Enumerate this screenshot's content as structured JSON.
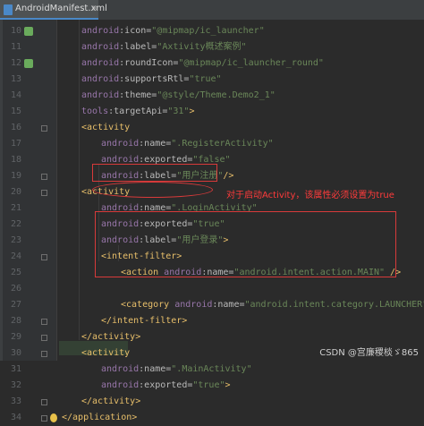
{
  "tab": {
    "label": "AndroidManifest.xml",
    "close": "×"
  },
  "lines": [
    {
      "n": "10",
      "indent": 1,
      "tokens": [
        [
          "ns",
          "android"
        ],
        [
          "attr",
          ":icon="
        ],
        [
          "val",
          "\"@mipmap/ic_launcher\""
        ]
      ],
      "badge": true
    },
    {
      "n": "11",
      "indent": 1,
      "tokens": [
        [
          "ns",
          "android"
        ],
        [
          "attr",
          ":label="
        ],
        [
          "val",
          "\"Axtivity概述案例\""
        ]
      ]
    },
    {
      "n": "12",
      "indent": 1,
      "tokens": [
        [
          "ns",
          "android"
        ],
        [
          "attr",
          ":roundIcon="
        ],
        [
          "val",
          "\"@mipmap/ic_launcher_round\""
        ]
      ],
      "badge": true
    },
    {
      "n": "13",
      "indent": 1,
      "tokens": [
        [
          "ns",
          "android"
        ],
        [
          "attr",
          ":supportsRtl="
        ],
        [
          "val",
          "\"true\""
        ]
      ]
    },
    {
      "n": "14",
      "indent": 1,
      "tokens": [
        [
          "ns",
          "android"
        ],
        [
          "attr",
          ":theme="
        ],
        [
          "val",
          "\"@style/Theme.Demo2_1\""
        ]
      ]
    },
    {
      "n": "15",
      "indent": 1,
      "tokens": [
        [
          "ns",
          "tools"
        ],
        [
          "attr",
          ":targetApi="
        ],
        [
          "val",
          "\"31\""
        ],
        [
          "tag",
          ">"
        ]
      ]
    },
    {
      "n": "16",
      "indent": 1,
      "tokens": [
        [
          "tag",
          "<activity"
        ]
      ],
      "fold": true
    },
    {
      "n": "17",
      "indent": 2,
      "tokens": [
        [
          "ns",
          "android"
        ],
        [
          "attr",
          ":name="
        ],
        [
          "val",
          "\".RegisterActivity\""
        ]
      ]
    },
    {
      "n": "18",
      "indent": 2,
      "tokens": [
        [
          "ns",
          "android"
        ],
        [
          "attr",
          ":exported="
        ],
        [
          "val",
          "\"false\""
        ]
      ]
    },
    {
      "n": "19",
      "indent": 2,
      "tokens": [
        [
          "ns",
          "android"
        ],
        [
          "attr",
          ":label="
        ],
        [
          "val",
          "\"用户注册\""
        ],
        [
          "tag",
          "/>"
        ]
      ],
      "fold": true
    },
    {
      "n": "20",
      "indent": 1,
      "tokens": [
        [
          "tag",
          "<activity"
        ]
      ],
      "fold": true
    },
    {
      "n": "21",
      "indent": 2,
      "tokens": [
        [
          "ns",
          "android"
        ],
        [
          "attr",
          ":name="
        ],
        [
          "val",
          "\".LoginActivity\""
        ]
      ]
    },
    {
      "n": "22",
      "indent": 2,
      "tokens": [
        [
          "ns",
          "android"
        ],
        [
          "attr",
          ":exported="
        ],
        [
          "val",
          "\"true\""
        ]
      ]
    },
    {
      "n": "23",
      "indent": 2,
      "tokens": [
        [
          "ns",
          "android"
        ],
        [
          "attr",
          ":label="
        ],
        [
          "val",
          "\"用户登录\""
        ],
        [
          "tag",
          ">"
        ]
      ]
    },
    {
      "n": "24",
      "indent": 2,
      "tokens": [
        [
          "tag",
          "<intent-filter>"
        ]
      ],
      "fold": true
    },
    {
      "n": "25",
      "indent": 3,
      "tokens": [
        [
          "tag",
          "<action "
        ],
        [
          "ns",
          "android"
        ],
        [
          "attr",
          ":name="
        ],
        [
          "val",
          "\"android.intent.action.MAIN\""
        ],
        [
          "tag",
          " />"
        ]
      ]
    },
    {
      "n": "26",
      "indent": 0,
      "tokens": []
    },
    {
      "n": "27",
      "indent": 3,
      "tokens": [
        [
          "tag",
          "<category "
        ],
        [
          "ns",
          "android"
        ],
        [
          "attr",
          ":name="
        ],
        [
          "val",
          "\"android.intent.category.LAUNCHER\""
        ],
        [
          "tag",
          " />"
        ]
      ]
    },
    {
      "n": "28",
      "indent": 2,
      "tokens": [
        [
          "tag",
          "</intent-filter>"
        ]
      ],
      "fold": true
    },
    {
      "n": "29",
      "indent": 1,
      "tokens": [
        [
          "tag",
          "</activity>"
        ]
      ],
      "fold": true
    },
    {
      "n": "30",
      "indent": 1,
      "tokens": [
        [
          "tag",
          "<activity"
        ]
      ],
      "fold": true
    },
    {
      "n": "31",
      "indent": 2,
      "tokens": [
        [
          "ns",
          "android"
        ],
        [
          "attr",
          ":name="
        ],
        [
          "val",
          "\".MainActivity\""
        ]
      ]
    },
    {
      "n": "32",
      "indent": 2,
      "tokens": [
        [
          "ns",
          "android"
        ],
        [
          "attr",
          ":exported="
        ],
        [
          "val",
          "\"true\""
        ],
        [
          "tag",
          ">"
        ]
      ]
    },
    {
      "n": "33",
      "indent": 1,
      "tokens": [
        [
          "tag",
          "</activity>"
        ]
      ],
      "fold": true
    },
    {
      "n": "34",
      "indent": 0,
      "tokens": [
        [
          "tag",
          "</application>"
        ]
      ],
      "fold": true,
      "bulb": true
    }
  ],
  "annotation": "对于启动Activity，该属性必须设置为true",
  "watermark": "CSDN @宫廉稷棪ゞ865",
  "colors": {
    "background": "#2b2b2b",
    "tag": "#e8bf6a",
    "namespace": "#9876aa",
    "value": "#6a8759",
    "highlight": "#d83a3a",
    "badge": "#6aab5c"
  }
}
